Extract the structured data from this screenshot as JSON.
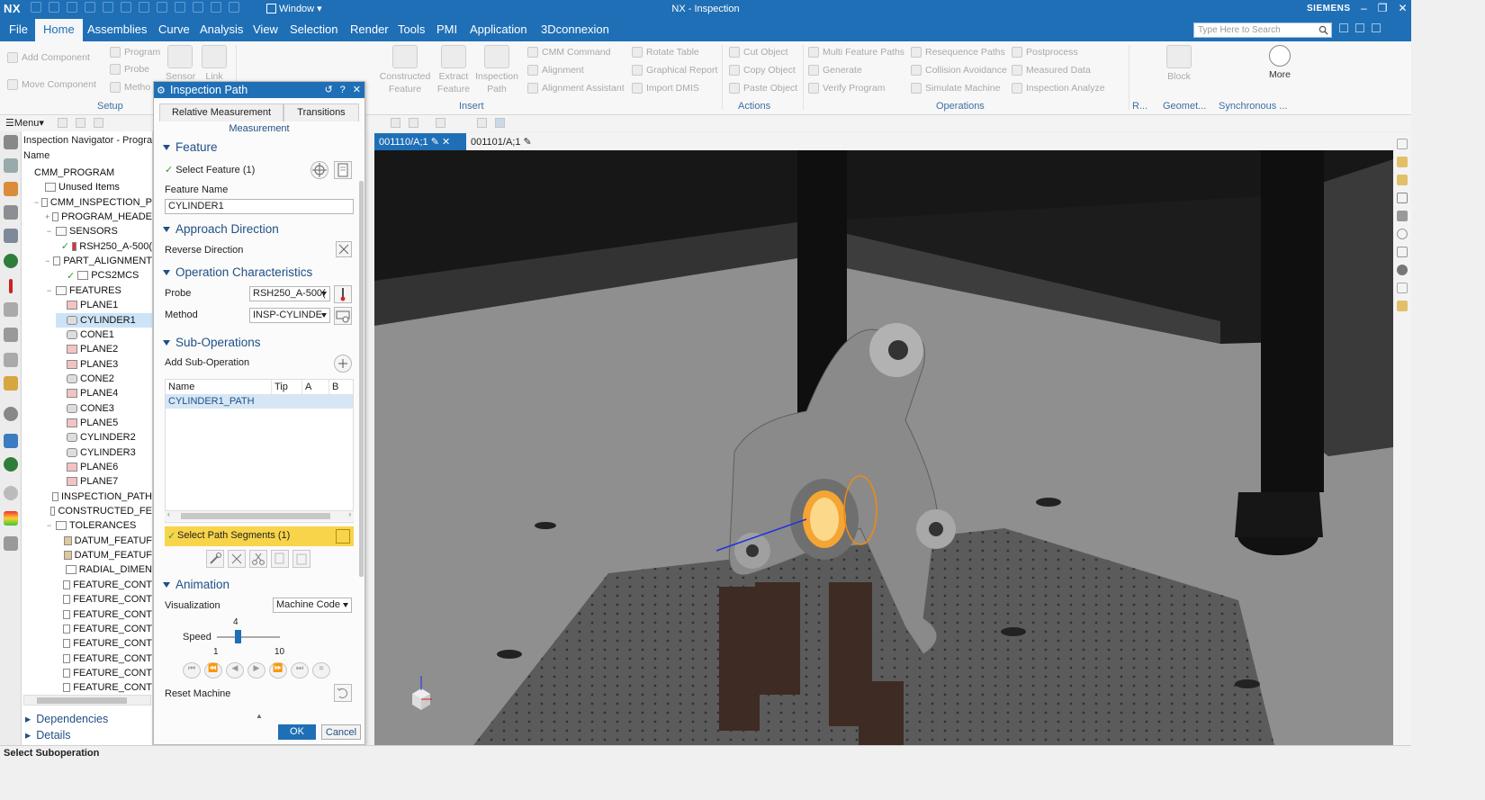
{
  "app": {
    "logo": "NX",
    "title": "NX - Inspection",
    "brand": "SIEMENS",
    "window_label": "Window"
  },
  "menu": {
    "items": [
      "File",
      "Home",
      "Assemblies",
      "Curve",
      "Analysis",
      "View",
      "Selection",
      "Render",
      "Tools",
      "PMI",
      "Application",
      "3Dconnexion"
    ],
    "active": "Home"
  },
  "search": {
    "placeholder": "Type Here to Search"
  },
  "ribbon": {
    "setup": {
      "add_component": "Add Component",
      "move_component": "Move Component",
      "program": "Program",
      "probe": "Probe",
      "method": "Metho",
      "sensor": "Sensor",
      "link": "Link",
      "group": "Setup"
    },
    "insert": {
      "constructed_feature": "Constructed Feature",
      "extract_feature": "Extract Feature",
      "inspection_path": "Inspection Path",
      "cmm_command": "CMM Command",
      "alignment": "Alignment",
      "alignment_assistant": "Alignment Assistant",
      "rotate_table": "Rotate Table",
      "graphical_report": "Graphical Report",
      "import_dmis": "Import DMIS",
      "group": "Insert"
    },
    "actions": {
      "cut": "Cut Object",
      "copy": "Copy Object",
      "paste": "Paste Object",
      "group": "Actions"
    },
    "operations": {
      "multi": "Multi Feature Paths",
      "generate": "Generate",
      "verify": "Verify Program",
      "resequence": "Resequence Paths",
      "collision": "Collision Avoidance",
      "simulate": "Simulate Machine",
      "postprocess": "Postprocess",
      "measured_data": "Measured Data",
      "inspection_analyze": "Inspection Analyze",
      "group": "Operations"
    },
    "block": "Block",
    "more": "More",
    "g_r": "R...",
    "g_geomet": "Geomet...",
    "g_sync": "Synchronous ..."
  },
  "toolbar2": {
    "menu": "Menu"
  },
  "navigator": {
    "title": "Inspection Navigator - Progra",
    "col_name": "Name",
    "items": [
      {
        "label": "CMM_PROGRAM",
        "indent": 0,
        "toggle": "",
        "icon": "none"
      },
      {
        "label": "Unused Items",
        "indent": 1,
        "toggle": "",
        "icon": "folder"
      },
      {
        "label": "CMM_INSPECTION_P",
        "indent": 1,
        "toggle": "−",
        "icon": "folder"
      },
      {
        "label": "PROGRAM_HEADE",
        "indent": 2,
        "toggle": "+",
        "icon": "folder"
      },
      {
        "label": "SENSORS",
        "indent": 2,
        "toggle": "−",
        "icon": "folder"
      },
      {
        "label": "RSH250_A-500(",
        "indent": 3,
        "toggle": "",
        "icon": "probe",
        "check": true
      },
      {
        "label": "PART_ALIGNMENT",
        "indent": 2,
        "toggle": "−",
        "icon": "folder"
      },
      {
        "label": "PCS2MCS",
        "indent": 3,
        "toggle": "",
        "icon": "doc",
        "check": true
      },
      {
        "label": "FEATURES",
        "indent": 2,
        "toggle": "−",
        "icon": "folder"
      },
      {
        "label": "PLANE1",
        "indent": 3,
        "toggle": "",
        "icon": "plane"
      },
      {
        "label": "CYLINDER1",
        "indent": 3,
        "toggle": "",
        "icon": "cyl",
        "selected": true
      },
      {
        "label": "CONE1",
        "indent": 3,
        "toggle": "",
        "icon": "cone"
      },
      {
        "label": "PLANE2",
        "indent": 3,
        "toggle": "",
        "icon": "plane"
      },
      {
        "label": "PLANE3",
        "indent": 3,
        "toggle": "",
        "icon": "plane"
      },
      {
        "label": "CONE2",
        "indent": 3,
        "toggle": "",
        "icon": "cone"
      },
      {
        "label": "PLANE4",
        "indent": 3,
        "toggle": "",
        "icon": "plane"
      },
      {
        "label": "CONE3",
        "indent": 3,
        "toggle": "",
        "icon": "cone"
      },
      {
        "label": "PLANE5",
        "indent": 3,
        "toggle": "",
        "icon": "plane"
      },
      {
        "label": "CYLINDER2",
        "indent": 3,
        "toggle": "",
        "icon": "cyl"
      },
      {
        "label": "CYLINDER3",
        "indent": 3,
        "toggle": "",
        "icon": "cyl"
      },
      {
        "label": "PLANE6",
        "indent": 3,
        "toggle": "",
        "icon": "plane"
      },
      {
        "label": "PLANE7",
        "indent": 3,
        "toggle": "",
        "icon": "plane"
      },
      {
        "label": "INSPECTION_PATH",
        "indent": 2,
        "toggle": "",
        "icon": "folder"
      },
      {
        "label": "CONSTRUCTED_FE",
        "indent": 2,
        "toggle": "",
        "icon": "folder"
      },
      {
        "label": "TOLERANCES",
        "indent": 2,
        "toggle": "−",
        "icon": "folder"
      },
      {
        "label": "DATUM_FEATUF",
        "indent": 3,
        "toggle": "",
        "icon": "datum"
      },
      {
        "label": "DATUM_FEATUF",
        "indent": 3,
        "toggle": "",
        "icon": "datum"
      },
      {
        "label": "RADIAL_DIMEN",
        "indent": 3,
        "toggle": "",
        "icon": "doc"
      },
      {
        "label": "FEATURE_CONT",
        "indent": 3,
        "toggle": "",
        "icon": "tol"
      },
      {
        "label": "FEATURE_CONT",
        "indent": 3,
        "toggle": "",
        "icon": "tol"
      },
      {
        "label": "FEATURE_CONT",
        "indent": 3,
        "toggle": "",
        "icon": "tol"
      },
      {
        "label": "FEATURE_CONT",
        "indent": 3,
        "toggle": "",
        "icon": "tol"
      },
      {
        "label": "FEATURE_CONT",
        "indent": 3,
        "toggle": "",
        "icon": "tol"
      },
      {
        "label": "FEATURE_CONT",
        "indent": 3,
        "toggle": "",
        "icon": "tol"
      },
      {
        "label": "FEATURE_CONT",
        "indent": 3,
        "toggle": "",
        "icon": "tol"
      },
      {
        "label": "FEATURE_CONT",
        "indent": 3,
        "toggle": "",
        "icon": "tol"
      }
    ],
    "dependencies": "Dependencies",
    "details": "Details"
  },
  "dialog": {
    "title": "Inspection Path",
    "tabs": [
      "Relative Measurement",
      "Transitions"
    ],
    "subtab": "Measurement",
    "feature": {
      "header": "Feature",
      "select": "Select Feature (1)",
      "name_label": "Feature Name",
      "name_value": "CYLINDER1"
    },
    "approach": {
      "header": "Approach Direction",
      "reverse": "Reverse Direction"
    },
    "opchar": {
      "header": "Operation Characteristics",
      "probe_label": "Probe",
      "probe_value": "RSH250_A-500(",
      "method_label": "Method",
      "method_value": "INSP-CYLINDE"
    },
    "subops": {
      "header": "Sub-Operations",
      "add": "Add Sub-Operation",
      "columns": [
        "Name",
        "Tip",
        "A",
        "B"
      ],
      "rows": [
        [
          "CYLINDER1_PATH",
          "",
          "",
          ""
        ]
      ],
      "select_path": "Select Path Segments (1)"
    },
    "animation": {
      "header": "Animation",
      "vis_label": "Visualization",
      "vis_value": "Machine Code",
      "speed_label": "Speed",
      "speed_value": "4",
      "speed_min": "1",
      "speed_max": "10",
      "speed_fraction": 0.33,
      "reset": "Reset Machine"
    },
    "ok": "OK",
    "cancel": "Cancel"
  },
  "view_tabs": [
    {
      "label": "001110/A;1",
      "active": true
    },
    {
      "label": "001101/A;1",
      "active": false
    }
  ],
  "status": "Select Suboperation",
  "colors": {
    "accent": "#1f6fb6",
    "highlight": "#f8d44a",
    "selection": "#cde3f7"
  }
}
